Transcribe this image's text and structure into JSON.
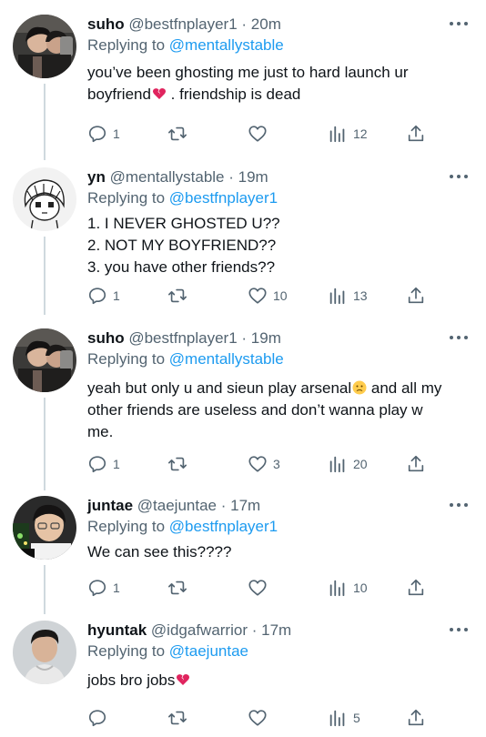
{
  "tweets": [
    {
      "name": "suho",
      "handle": "@bestfnplayer1",
      "time": "· 20m",
      "reply_prefix": "Replying to",
      "reply_to": "@mentallystable",
      "lines": [
        "you’ve been ghosting me just to hard launch ur",
        "boyfriend",
        " . friendship is dead"
      ],
      "emoji": "broken-heart",
      "replies": "1",
      "retweets": "",
      "likes": "",
      "views": "12",
      "avatar": "suho-avatar"
    },
    {
      "name": "yn",
      "handle": "@mentallystable",
      "time": "· 19m",
      "reply_prefix": "Replying to",
      "reply_to": "@bestfnplayer1",
      "lines": [
        "1. I NEVER GHOSTED U??",
        "2. NOT MY BOYFRIEND??",
        "3. you have other friends??"
      ],
      "replies": "1",
      "retweets": "",
      "likes": "10",
      "views": "13",
      "avatar": "yn-avatar"
    },
    {
      "name": "suho",
      "handle": "@bestfnplayer1",
      "time": "· 19m",
      "reply_prefix": "Replying to",
      "reply_to": "@mentallystable",
      "lines": [
        "yeah but only u and sieun play arsenal",
        " and all my",
        "other friends are useless and don’t wanna play w",
        "me."
      ],
      "emoji": "frowning-face",
      "replies": "1",
      "retweets": "",
      "likes": "3",
      "views": "20",
      "avatar": "suho-avatar"
    },
    {
      "name": "juntae",
      "handle": "@taejuntae",
      "time": "· 17m",
      "reply_prefix": "Replying to",
      "reply_to": "@bestfnplayer1",
      "lines": [
        "We can see this????"
      ],
      "replies": "1",
      "retweets": "",
      "likes": "",
      "views": "10",
      "avatar": "juntae-avatar"
    },
    {
      "name": "hyuntak",
      "handle": "@idgafwarrior",
      "time": "· 17m",
      "reply_prefix": "Replying to",
      "reply_to": "@taejuntae",
      "lines": [
        "jobs bro jobs"
      ],
      "emoji": "broken-heart",
      "replies": "",
      "retweets": "",
      "likes": "",
      "views": "5",
      "avatar": "hyuntak-avatar"
    }
  ],
  "colors": {
    "text": "#0f1419",
    "secondary": "#536471",
    "mention": "#1d9bf0",
    "thread_line": "#cfd9de"
  },
  "icons": [
    "reply-icon",
    "retweet-icon",
    "like-icon",
    "views-icon",
    "share-icon",
    "more-icon"
  ]
}
